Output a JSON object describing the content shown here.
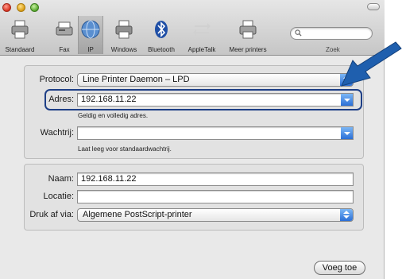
{
  "toolbar": {
    "items": [
      {
        "label": "Standaard",
        "icon": "printer-icon"
      },
      {
        "label": "Fax",
        "icon": "fax-icon"
      },
      {
        "label": "IP",
        "icon": "network-globe-icon"
      },
      {
        "label": "Windows",
        "icon": "windows-printer-icon"
      },
      {
        "label": "Bluetooth",
        "icon": "bluetooth-icon"
      },
      {
        "label": "AppleTalk",
        "icon": "appletalk-icon"
      },
      {
        "label": "Meer printers",
        "icon": "more-printers-icon"
      }
    ],
    "selected": "IP",
    "search_label": "Zoek",
    "search_value": ""
  },
  "form": {
    "protocol_label": "Protocol:",
    "protocol_value": "Line Printer Daemon – LPD",
    "address_label": "Adres:",
    "address_value": "192.168.11.22",
    "address_hint": "Geldig en volledig adres.",
    "queue_label": "Wachtrij:",
    "queue_value": "",
    "queue_hint": "Laat leeg voor standaardwachtrij.",
    "name_label": "Naam:",
    "name_value": "192.168.11.22",
    "location_label": "Locatie:",
    "location_value": "",
    "driver_label": "Druk af via:",
    "driver_value": "Algemene PostScript-printer"
  },
  "buttons": {
    "add_label": "Voeg toe"
  },
  "colors": {
    "accent_blue": "#2b6fd6",
    "callout_arrow": "#1f5fae",
    "highlight_border": "#1e3f86"
  }
}
